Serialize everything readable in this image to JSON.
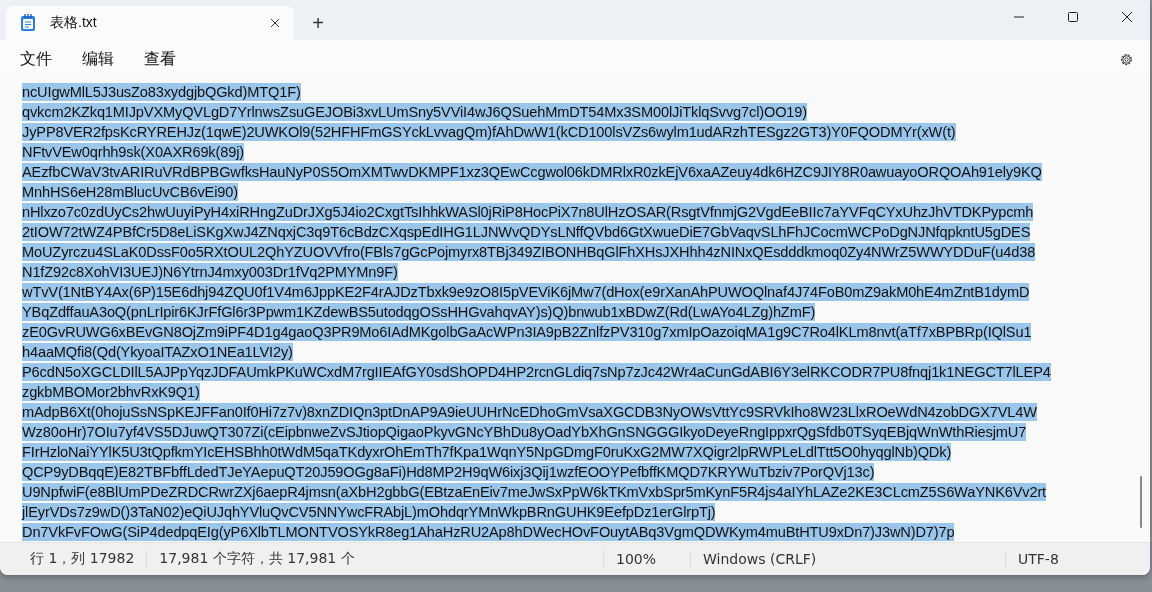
{
  "tabs": [
    {
      "title": "表格.txt",
      "selected": true
    }
  ],
  "new_tab": "+",
  "menu": [
    "文件",
    "编辑",
    "查看"
  ],
  "editor": {
    "selected": true,
    "lines": [
      "ncUIgwMlL5J3usZo83xydgjbQGkd)MTQ1F)",
      "qvkcm2KZkq1MIJpVXMyQVLgD7YrlnwsZsuGEJOBi3xvLUmSny5VViI4wJ6QSuehMmDT54Mx3SM00lJiTklqSvvg7cl)OO19)",
      "JyPP8VER2fpsKcRYREHJz(1qwE)2UWKOl9(52HFHFmGSYckLvvagQm)fAhDwW1(kCD100lsVZs6wylm1udARzhTESgz2GT3)Y0FQODMYr(xW(t)",
      "NFtvVEw0qrhh9sk(X0AXR69k(89j)",
      "AEzfbCWaV3tvARIRuVRdBPBGwfksHauNyP0S5OmXMTwvDKMPF1xz3QEwCcgwol06kDMRlxR0zkEjV6xaAZeuy4dk6HZC9JIY8R0awuayoORQOAh91ely9KQ",
      "MnhHS6eH28mBlucUvCB6vEi90)",
      "nHlxzo7c0zdUyCs2hwUuyiPyH4xiRHngZuDrJXg5J4io2CxgtTsIhhkWASl0jRiP8HocPiX7n8UlHzOSAR(RsgtVfnmjG2VgdEeBIIc7aYVFqCYxUhzJhVTDKPypcmh",
      "2tIOW72tWZ4PBfCr5D8eLiSKgXwJ4ZNqxjC3q9T6cBdzCXqspEdIHG1LJNWvQDYsLNffQVbd6GtXwueDiE7GbVaqvSLhFhJCocmWCPoDgNJNfqpkntU5gDES",
      "MoUZyrczu4SLaK0DssF0o5RXtOUL2QhYZUOVVfro(FBls7gGcPojmyrx8TBj349ZIBONHBqGlFhXHsJXHhh4zNINxQEsdddkmoq0Zy4NWrZ5WWYDDuF(u4d38",
      "N1fZ92c8XohVI3UEJ)N6YtrnJ4mxy003Dr1fVq2PMYMn9F)",
      "wTvV(1NtBY4Ax(6P)15E6dhj94ZQU0f1V4m6JppKE2F4rAJDzTbxk9e9zO8I5pVEViK6jMw7(dHox(e9rXanAhPUWOQlnaf4J74FoB0mZ9akM0hE4mZntB1dymD",
      "YBqZdffauA3oQ(pnLrIpir6KJrFfGl6r3Ppwm1KZdewBS5utodqgOSsHHGvahqvAY)s)Q)bnwub1xBDwZ(Rd(LwAYo4LZg)hZmF)",
      "zE0GvRUWG6xBEvGN8OjZm9iPF4D1g4gaoQ3PR9Mo6IAdMKgolbGaAcWPn3IA9pB2ZnlfzPV310g7xmIpOazoiqMA1g9C7Ro4lKLm8nvt(aTf7xBPBRp(IQlSu1",
      "h4aaMQfi8(Qd(YkyoaITAZxO1NEa1LVI2y)",
      "P6cdN5oXGCLDIlL5AJPpYqzJDFAUmkPKuWCxdM7rgIIEAfGY0sdShOPD4HP2rcnGLdiq7sNp7zJc42Wr4aCunGdABI6Y3elRKCODR7PU8fnqj1k1NEGCT7lLEP4",
      "zgkbMBOMor2bhvRxK9Q1)",
      "mAdpB6Xt(0hojuSsNSpKEJFFan0If0Hi7z7v)8xnZDIQn3ptDnAP9A9ieUUHrNcEDhoGmVsaXGCDB3NyOWsVttYc9SRVkIho8W23LlxROeWdN4zobDGX7VL4W",
      "Wz80oHr)7OIu7yf4VS5DJuwQT307Zi(cEipbnweZvSJtiopQigaoPkyvGNcYBhDu8yOadYbXhGnSNGGGIkyoDeyeRngIppxrQgSfdb0TSyqEBjqWnWthRiesjmU7",
      "FIrHzloNaiYYlK5U3tQpfkmYIcEHSBhh0tWdM5qaTKdyxrOhEmTh7fKpa1WqnY5NpGDmgF0ruKxG2MW7XQigr2lpRWPLeLdlTtt5O0hyqglNb)QDk)",
      "QCP9yDBqqE)E82TBFbffLdedTJeYAepuQT20J59OGg8aFi)Hd8MP2H9qW6ixj3Qij1wzfEOOYPefbffKMQD7KRYWuTbziv7PorQVj13c)",
      "U9NpfwiF(e8BlUmPDeZRDCRwrZXj6aepR4jmsn(aXbH2gbbG(EBtzaEnEiv7meJwSxPpW6kTKmVxbSpr5mKynF5R4js4aIYhLAZe2KE3CLcmZ5S6WaYNK6Vv2rt",
      "jlEyrVDs7z9wD()3TaN02)eQiUJqhYVluQvCV5NNYwcFRAbjL)mOhdqrYMnWkpBRnGUHK9EefpDz1erGlrpTj)",
      "Dn7VkFvFOwG(SiP4dedpqEIg(yP6XlbTLMONTVOSYkR8eg1AhaHzRU2Ap8hDWecHOvFOuytABq3VgmQDWKym4muBtHTU9xDn7)J3wN)D7)7p"
    ]
  },
  "status_bar": [
    "行 1，列 17982",
    "17,981 个字符，共 17,981 个",
    "100%",
    "Windows (CRLF)",
    "UTF-8"
  ]
}
